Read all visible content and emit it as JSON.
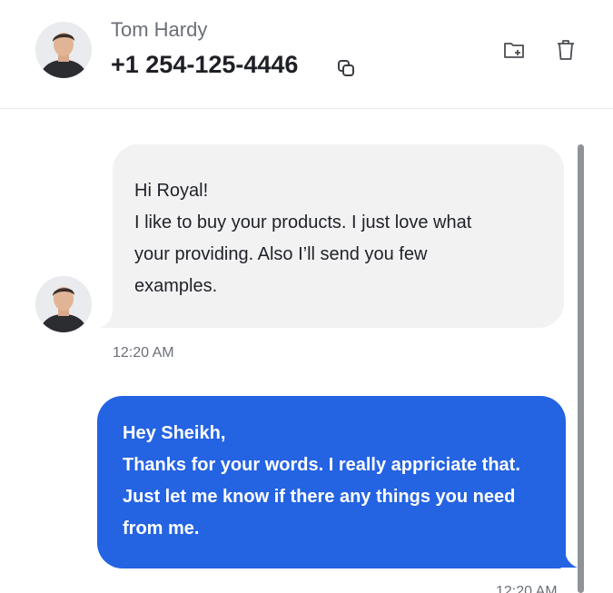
{
  "header": {
    "contact_name": "Tom Hardy",
    "contact_phone": "+1 254-125-4446",
    "icons": {
      "copy": "copy-icon",
      "add_folder": "folder-add-icon",
      "delete": "trash-icon"
    }
  },
  "messages": [
    {
      "direction": "incoming",
      "lines": [
        "Hi Royal!",
        "I like to buy your products. I just love what",
        "your providing. Also I’ll send you few",
        "examples."
      ],
      "time": "12:20 AM"
    },
    {
      "direction": "outgoing",
      "lines": [
        "Hey Sheikh,",
        "Thanks for your words. I really appriciate that.",
        "Just let me know if there any things you need",
        "from me."
      ],
      "time": "12:20 AM"
    }
  ],
  "colors": {
    "outgoing_bubble": "#2463e2",
    "incoming_bubble": "#f2f2f3",
    "scrollbar": "#8f9296"
  }
}
